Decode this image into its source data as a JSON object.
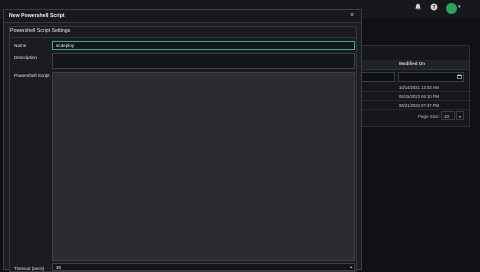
{
  "background": {
    "table": {
      "modified_header": "Modified On",
      "rows": [
        "10/14/2021 12:03 AM",
        "06/15/2023 06:10 PM",
        "06/21/2023 07:47 PM"
      ]
    },
    "pager": {
      "page_size_label": "Page Size:",
      "page_size_value": "10"
    }
  },
  "modal": {
    "title": "New Powershell Script",
    "close_glyph": "×",
    "section_title": "Powershell Script Settings",
    "fields": {
      "name_label": "Name",
      "name_value": "scdeploy",
      "description_label": "Description",
      "description_value": "",
      "script_label": "Powershell Script",
      "script_value": "",
      "timeout_label": "Timeout (secs)",
      "timeout_value": "30"
    }
  },
  "icons": {
    "bell": "bell-icon",
    "help": "help-icon",
    "avatar": "user-avatar",
    "calendar": "calendar-icon"
  },
  "colors": {
    "accent": "#2bb673",
    "avatar": "#27a35a"
  }
}
